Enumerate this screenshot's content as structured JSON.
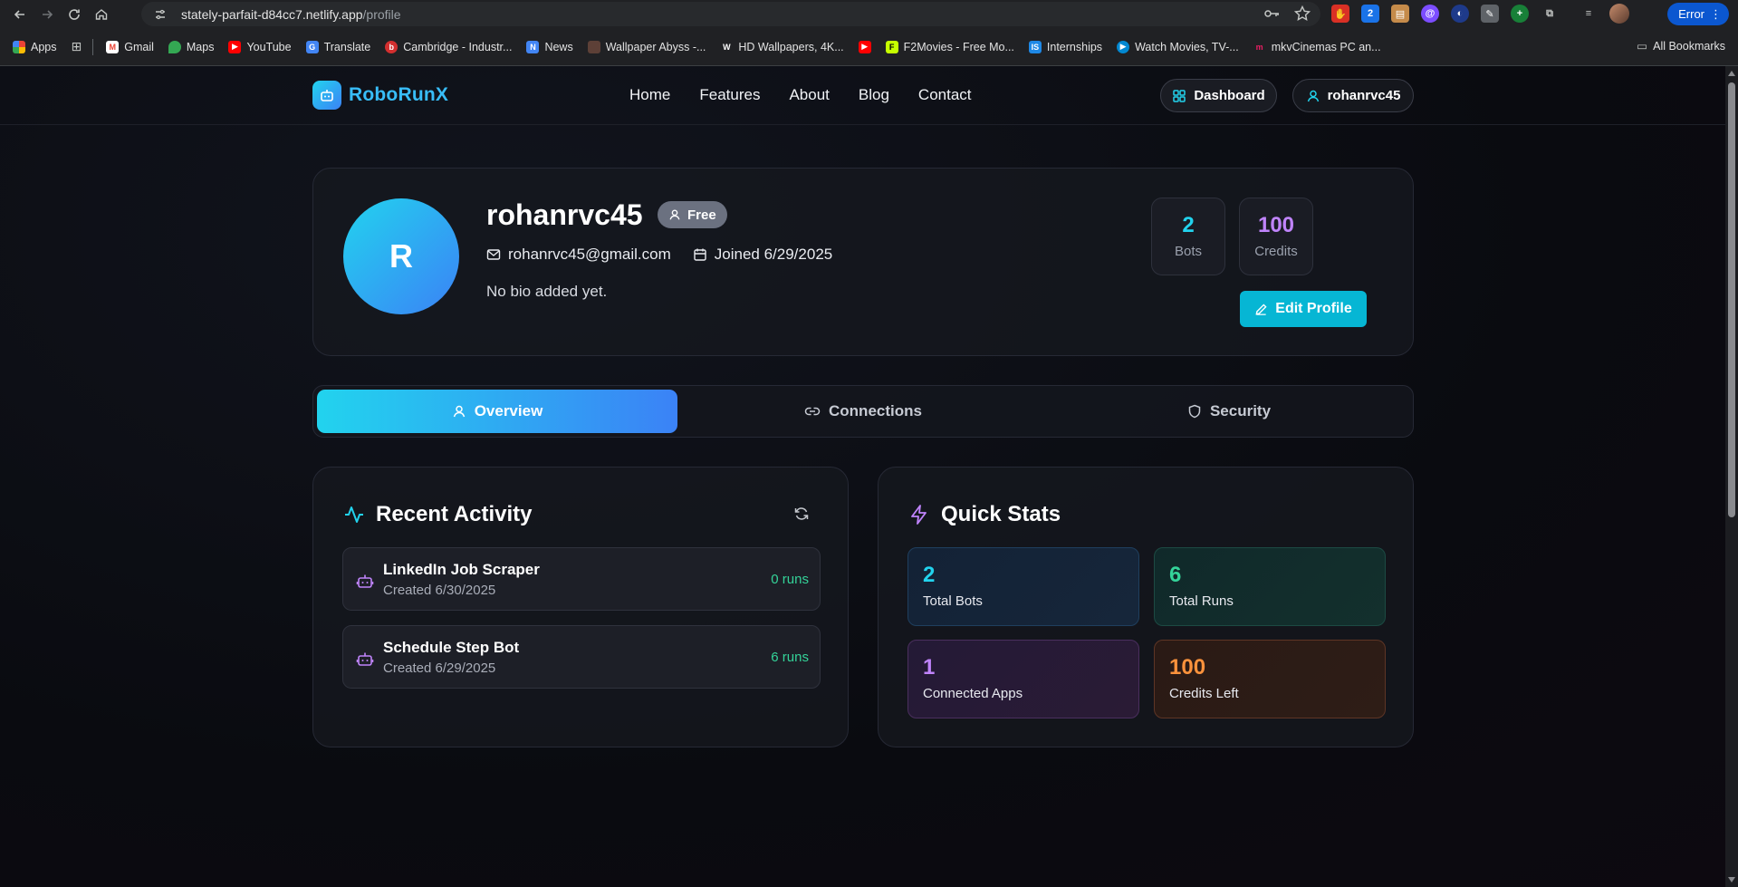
{
  "browser": {
    "url_host": "stately-parfait-d84cc7.netlify.app",
    "url_path": "/profile",
    "error_label": "Error",
    "bookmarks": [
      "Apps",
      "Gmail",
      "Maps",
      "YouTube",
      "Translate",
      "Cambridge - Industr...",
      "News",
      "Wallpaper Abyss -...",
      "HD Wallpapers, 4K...",
      "F2Movies - Free Mo...",
      "Internships",
      "Watch Movies, TV-...",
      "mkvCinemas PC an..."
    ],
    "all_bookmarks": "All Bookmarks"
  },
  "nav": {
    "brand": "RoboRunX",
    "links": [
      "Home",
      "Features",
      "About",
      "Blog",
      "Contact"
    ],
    "dashboard": "Dashboard",
    "user": "rohanrvc45"
  },
  "profile": {
    "initial": "R",
    "username": "rohanrvc45",
    "plan": "Free",
    "email": "rohanrvc45@gmail.com",
    "joined": "Joined 6/29/2025",
    "bio": "No bio added yet.",
    "stats": [
      {
        "value": "2",
        "label": "Bots",
        "color": "#22d3ee"
      },
      {
        "value": "100",
        "label": "Credits",
        "color": "#c084fc"
      }
    ],
    "edit_button": "Edit Profile"
  },
  "tabs": [
    "Overview",
    "Connections",
    "Security"
  ],
  "recent_activity": {
    "title": "Recent Activity",
    "items": [
      {
        "name": "LinkedIn Job Scraper",
        "date": "Created 6/30/2025",
        "runs": "0 runs"
      },
      {
        "name": "Schedule Step Bot",
        "date": "Created 6/29/2025",
        "runs": "6 runs"
      }
    ]
  },
  "quick_stats": {
    "title": "Quick Stats",
    "items": [
      {
        "value": "2",
        "label": "Total Bots",
        "color": "#22d3ee"
      },
      {
        "value": "6",
        "label": "Total Runs",
        "color": "#34d399"
      },
      {
        "value": "1",
        "label": "Connected Apps",
        "color": "#c084fc"
      },
      {
        "value": "100",
        "label": "Credits Left",
        "color": "#fb923c"
      }
    ]
  }
}
